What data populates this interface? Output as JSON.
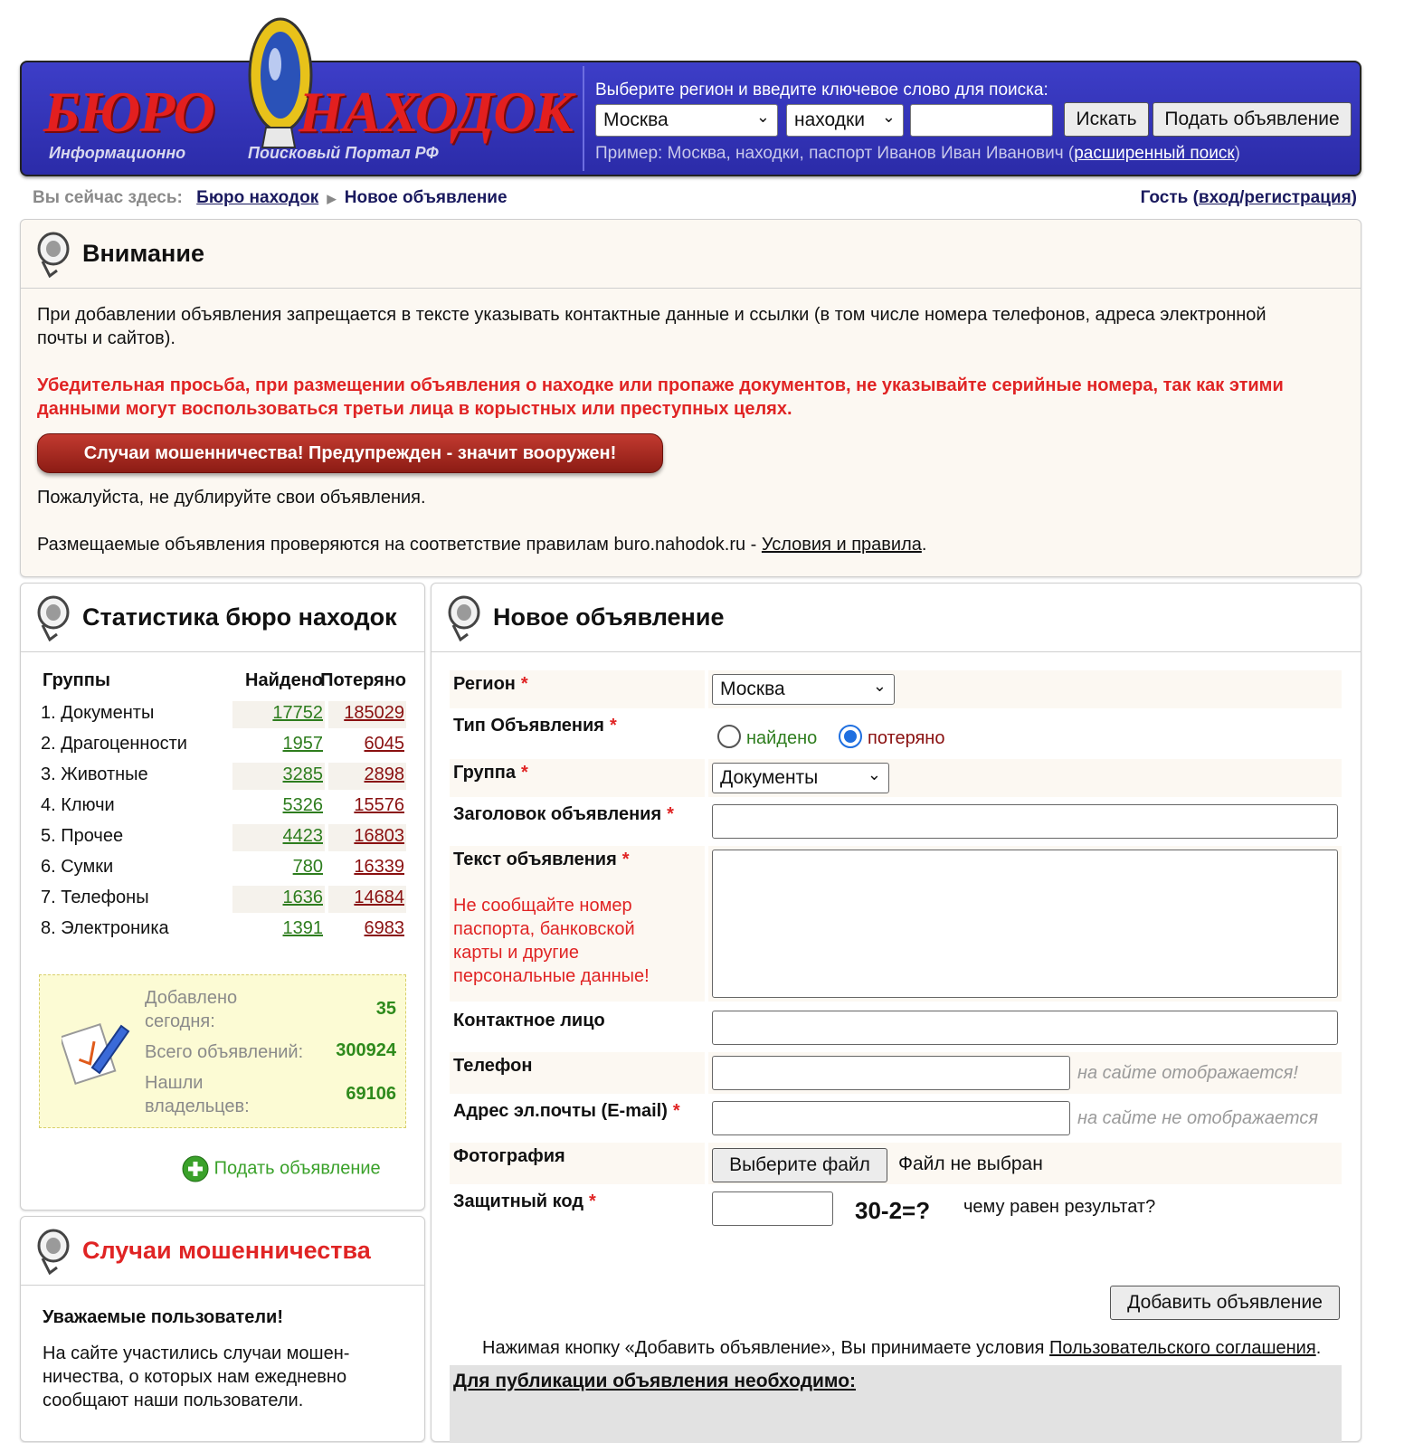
{
  "header": {
    "logo_word1": "БЮРО",
    "logo_word2": "НАХОДОК",
    "logo_sub1": "Информационно",
    "logo_sub2": "Поисковый Портал РФ",
    "search_prompt": "Выберите регион и введите ключевое слово для поиска:",
    "region_select": "Москва",
    "type_select": "находки",
    "keyword_value": "",
    "search_button": "Искать",
    "post_button": "Подать объявление",
    "example_prefix": "Пример: Москва, находки, паспорт Иванов Иван Иванович (",
    "advanced_search_link": "расширенный поиск",
    "example_suffix": ")"
  },
  "breadcrumb": {
    "label": "Вы сейчас здесь:",
    "home": "Бюро находок",
    "current": "Новое объявление"
  },
  "user": {
    "guest": "Гость (",
    "login_link": "вход",
    "slash": "/",
    "register_link": "регистрация",
    "close": ")"
  },
  "attention": {
    "title": "Внимание",
    "rule": "При добавлении объявления запрещается в тексте указывать контактные данные и ссылки (в том числе номера телефонов, адреса электронной почты и сайтов).",
    "warning": "Убедительная просьба, при размещении объявления о находке или пропаже документов, не указывайте серийные номера, так как этими данными могут воспользоваться третьи лица в корыстных или преступных целях.",
    "fraud_button": "Случаи мошенничества! Предупрежден - значит вооружен!",
    "no_duplicate": "Пожалуйста, не дублируйте свои объявления.",
    "check_prefix": "Размещаемые объявления проверяются на соответствие правилам buro.nahodok.ru - ",
    "check_link": "Условия и правила",
    "check_suffix": "."
  },
  "stats": {
    "title": "Статистика бюро находок",
    "col_groups": "Группы",
    "col_found": "Найдено",
    "col_lost": "Потеряно",
    "rows": [
      {
        "label": "1. Документы",
        "found": "17752",
        "lost": "185029"
      },
      {
        "label": "2. Драгоценности",
        "found": "1957",
        "lost": "6045"
      },
      {
        "label": "3. Животные",
        "found": "3285",
        "lost": "2898"
      },
      {
        "label": "4. Ключи",
        "found": "5326",
        "lost": "15576"
      },
      {
        "label": "5. Прочее",
        "found": "4423",
        "lost": "16803"
      },
      {
        "label": "6. Сумки",
        "found": "780",
        "lost": "16339"
      },
      {
        "label": "7. Телефоны",
        "found": "1636",
        "lost": "14684"
      },
      {
        "label": "8. Электроника",
        "found": "1391",
        "lost": "6983"
      }
    ],
    "added_today_label_1": "Добавлено",
    "added_today_label_2": "сегодня:",
    "added_today_value": "35",
    "total_label": "Всего объявлений:",
    "total_value": "300924",
    "found_owners_label_1": "Нашли",
    "found_owners_label_2": "владельцев:",
    "found_owners_value": "69106",
    "post_link": "Подать объявление"
  },
  "fraud": {
    "title": "Случаи мошенничества",
    "greeting": "Уважаемые пользователи!",
    "text": "На сайте участились случаи мошен-ничества, о которых нам ежедневно сообщают наши пользователи."
  },
  "form": {
    "title": "Новое объявление",
    "region_label": "Регион",
    "region_value": "Москва",
    "type_label": "Тип Объявления",
    "type_found": "найдено",
    "type_lost": "потеряно",
    "group_label": "Группа",
    "group_value": "Документы",
    "headline_label": "Заголовок объявления",
    "text_label": "Текст объявления",
    "text_warning": "Не сообщайте номер паспорта, банковской карты и другие персональные данные!",
    "contact_label": "Контактное лицо",
    "phone_label": "Телефон",
    "phone_hint": "на сайте отображается!",
    "email_label": "Адрес эл.почты (E-mail)",
    "email_hint": "на сайте не отображается",
    "photo_label": "Фотография",
    "file_button": "Выберите файл",
    "file_status": "Файл не выбран",
    "captcha_label": "Защитный код",
    "captcha_question": "30-2=?",
    "captcha_hint": "чему равен результат?",
    "required_mark": "*",
    "submit": "Добавить объявление",
    "agreement_prefix": "Нажимая кнопку «Добавить объявление», Вы принимаете условия ",
    "agreement_link": "Пользовательского соглашения",
    "agreement_suffix": ".",
    "publish_title": "Для публикации объявления необходимо:"
  },
  "colors": {
    "header_bg": "#2b2ba8",
    "accent_red": "#e02424",
    "found_green": "#2e7d1e",
    "lost_red": "#8a1010"
  }
}
